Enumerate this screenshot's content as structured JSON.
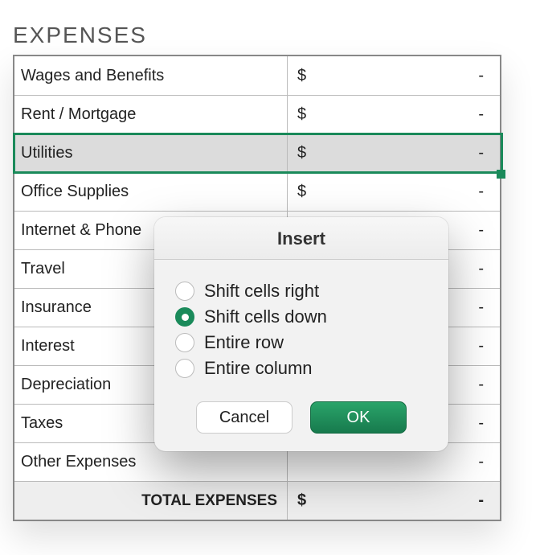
{
  "header": {
    "title": "EXPENSES"
  },
  "table": {
    "rows": [
      {
        "label": "Wages and Benefits",
        "currency": "$",
        "amount": "-"
      },
      {
        "label": "Rent / Mortgage",
        "currency": "$",
        "amount": "-"
      },
      {
        "label": "Utilities",
        "currency": "$",
        "amount": "-",
        "selected": true
      },
      {
        "label": "Office Supplies",
        "currency": "$",
        "amount": "-"
      },
      {
        "label": "Internet & Phone",
        "currency": "",
        "amount": "-"
      },
      {
        "label": "Travel",
        "currency": "",
        "amount": "-"
      },
      {
        "label": "Insurance",
        "currency": "",
        "amount": "-"
      },
      {
        "label": "Interest",
        "currency": "",
        "amount": "-"
      },
      {
        "label": "Depreciation",
        "currency": "",
        "amount": "-"
      },
      {
        "label": "Taxes",
        "currency": "",
        "amount": "-"
      },
      {
        "label": "Other Expenses",
        "currency": "",
        "amount": "-"
      }
    ],
    "total": {
      "label": "TOTAL EXPENSES",
      "currency": "$",
      "amount": "-"
    }
  },
  "dialog": {
    "title": "Insert",
    "options": {
      "shift_right": "Shift cells right",
      "shift_down": "Shift cells down",
      "entire_row": "Entire row",
      "entire_col": "Entire column"
    },
    "selected": "shift_down",
    "buttons": {
      "cancel": "Cancel",
      "ok": "OK"
    }
  }
}
